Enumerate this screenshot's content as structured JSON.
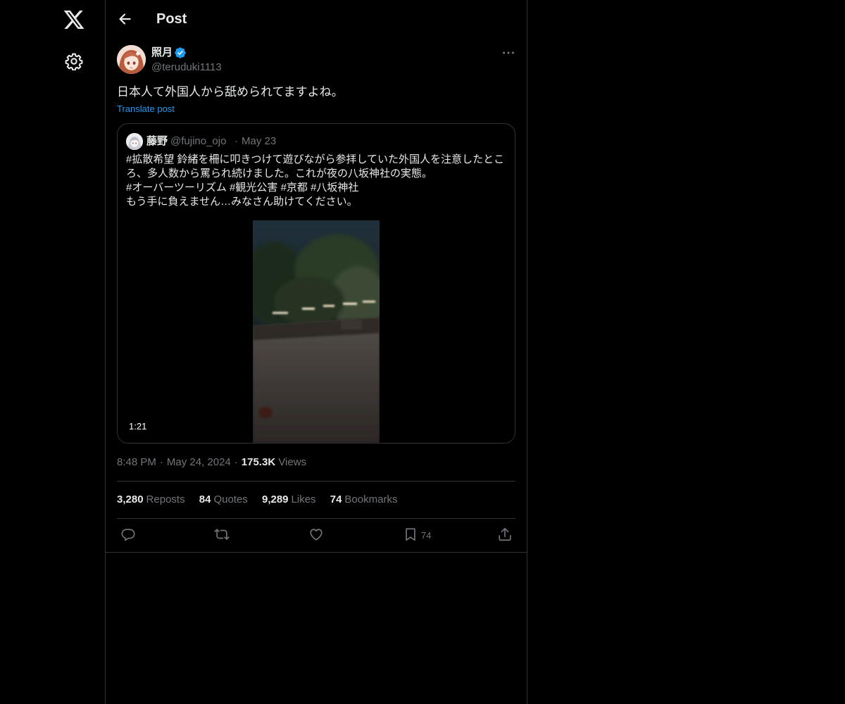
{
  "header": {
    "title": "Post"
  },
  "author": {
    "display_name": "照月",
    "handle": "@teruduki1113",
    "verified": true
  },
  "post": {
    "text": "日本人て外国人から舐められてますよね。",
    "translate_label": "Translate post"
  },
  "quoted": {
    "display_name": "藤野",
    "handle": "@fujino_ojo",
    "separator": "·",
    "date": "May 23",
    "lines": [
      "#拡散希望 鈴緒を柵に叩きつけて遊びながら参拝していた外国人を注意したとこ",
      "ろ、多人数から罵られ続けました。これが夜の八坂神社の実態。",
      "#オーバーツーリズム #観光公害 #京都 #八坂神社",
      "もう手に負えません…みなさん助けてください。"
    ],
    "video_duration": "1:21"
  },
  "meta": {
    "time": "8:48 PM",
    "date": "May 24, 2024",
    "views_count": "175.3K",
    "views_label": "Views",
    "separator": "·"
  },
  "stats": {
    "reposts_count": "3,280",
    "reposts_label": "Reposts",
    "quotes_count": "84",
    "quotes_label": "Quotes",
    "likes_count": "9,289",
    "likes_label": "Likes",
    "bookmarks_count": "74",
    "bookmarks_label": "Bookmarks"
  },
  "actions": {
    "bookmark_count": "74"
  },
  "icons": {
    "logo": "x-logo-icon",
    "settings": "gear-icon",
    "back": "arrow-left-icon",
    "verified": "verified-badge-icon",
    "more": "more-horizontal-icon",
    "reply": "reply-icon",
    "repost": "repost-icon",
    "like": "heart-icon",
    "bookmark": "bookmark-icon",
    "share": "share-icon"
  },
  "colors": {
    "background": "#000000",
    "text_primary": "#e7e9ea",
    "text_secondary": "#71767b",
    "accent": "#1d9bf0",
    "border": "#2f3336"
  }
}
